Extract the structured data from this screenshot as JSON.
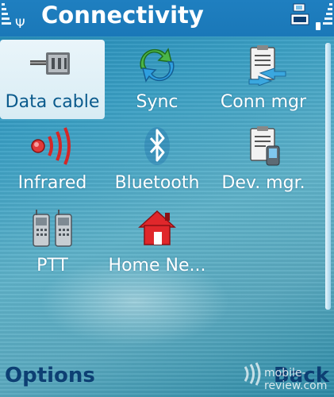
{
  "header": {
    "title": "Connectivity"
  },
  "grid": {
    "items": [
      {
        "label": "Data cable",
        "icon": "usb-cable-icon",
        "selected": true
      },
      {
        "label": "Sync",
        "icon": "sync-icon",
        "selected": false
      },
      {
        "label": "Conn mgr",
        "icon": "connection-manager-icon",
        "selected": false
      },
      {
        "label": "Infrared",
        "icon": "infrared-icon",
        "selected": false
      },
      {
        "label": "Bluetooth",
        "icon": "bluetooth-icon",
        "selected": false
      },
      {
        "label": "Dev. mgr.",
        "icon": "device-manager-icon",
        "selected": false
      },
      {
        "label": "PTT",
        "icon": "push-to-talk-icon",
        "selected": false
      },
      {
        "label": "Home Ne...",
        "icon": "home-network-icon",
        "selected": false
      }
    ]
  },
  "softkeys": {
    "left": "Options",
    "right": "Back"
  },
  "watermark": {
    "text": "mobile-review.com"
  },
  "colors": {
    "status_bar": "#1a78b8",
    "softkey_text": "#0d3f73",
    "selected_label": "#0a5a8c",
    "highlight": "#eaf5fa"
  }
}
